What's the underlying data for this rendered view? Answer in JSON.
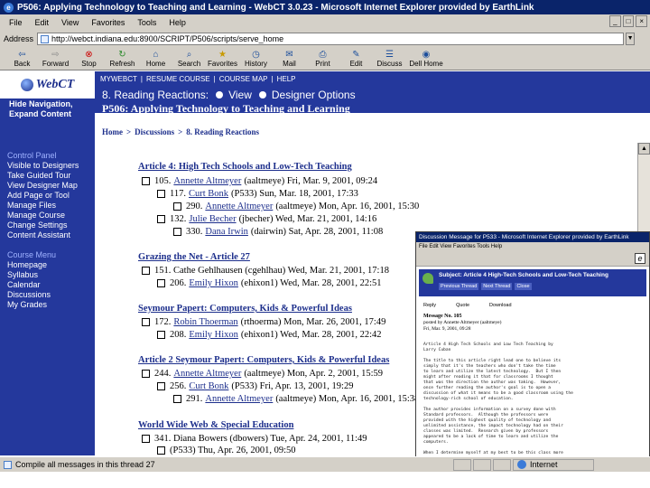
{
  "window": {
    "title": "P506: Applying Technology to Teaching and Learning - WebCT 3.0.23 - Microsoft Internet Explorer provided by EarthLink"
  },
  "menu": [
    "File",
    "Edit",
    "View",
    "Favorites",
    "Tools",
    "Help"
  ],
  "address": {
    "label": "Address",
    "url": "http://webct.indiana.edu:8900/SCRIPT/P506/scripts/serve_home"
  },
  "toolbar": [
    {
      "label": "Back",
      "icon": "back-arrow-icon"
    },
    {
      "label": "Forward",
      "icon": "forward-arrow-icon"
    },
    {
      "label": "Stop",
      "icon": "stop-icon"
    },
    {
      "label": "Refresh",
      "icon": "refresh-icon"
    },
    {
      "label": "Home",
      "icon": "home-icon"
    },
    {
      "label": "Search",
      "icon": "search-icon"
    },
    {
      "label": "Favorites",
      "icon": "favorites-icon"
    },
    {
      "label": "History",
      "icon": "history-icon"
    },
    {
      "label": "Mail",
      "icon": "mail-icon"
    },
    {
      "label": "Print",
      "icon": "print-icon"
    },
    {
      "label": "Edit",
      "icon": "edit-icon"
    },
    {
      "label": "Discuss",
      "icon": "discuss-icon"
    },
    {
      "label": "Dell Home",
      "icon": "dell-icon"
    }
  ],
  "sidebar": {
    "logo": "WebCT",
    "hide_nav": "Hide Navigation,",
    "expand": "Expand Content",
    "control_panel": {
      "header": "Control Panel",
      "items": [
        "Visible to Designers",
        "Take Guided Tour",
        "View Designer Map",
        "Add Page or Tool",
        "Manage Files",
        "Manage Course",
        "Change Settings",
        "Content Assistant"
      ]
    },
    "course_menu": {
      "header": "Course Menu",
      "items": [
        "Homepage",
        "Syllabus",
        "Calendar",
        "Discussions",
        "My Grades"
      ]
    }
  },
  "navrow": [
    "MYWEBCT",
    "RESUME COURSE",
    "COURSE MAP",
    "HELP"
  ],
  "topic": {
    "heading": "8. Reading Reactions:",
    "view": "View",
    "designer": "Designer Options",
    "course": "P506: Applying Technology to Teaching and Learning"
  },
  "breadcrumb": [
    "Home",
    "Discussions",
    "8. Reading Reactions"
  ],
  "threads": [
    {
      "title": "Article 4: High Tech Schools and Low-Tech Teaching",
      "messages": [
        {
          "id": "105.",
          "author": "Annette Altmeyer",
          "rest": "(aaltmeye) Fri, Mar. 9, 2001, 09:24"
        },
        {
          "id": "117.",
          "author": "Curt Bonk",
          "rest": "(P533) Sun, Mar. 18, 2001, 17:33"
        },
        {
          "id": "290.",
          "author": "Annette Altmeyer",
          "rest": "(aaltmeye) Mon, Apr. 16, 2001, 15:30"
        },
        {
          "id": "132.",
          "author": "Julie Becher",
          "rest": "(jbecher) Wed, Mar. 21, 2001, 14:16"
        },
        {
          "id": "330.",
          "author": "Dana Irwin",
          "rest": "(dairwin) Sat, Apr. 28, 2001, 11:08"
        }
      ]
    },
    {
      "title": "Grazing the Net - Article 27",
      "messages": [
        {
          "id": "151.",
          "author": "",
          "rest": "Cathe Gehlhausen (cgehlhau) Wed, Mar. 21, 2001, 17:18"
        },
        {
          "id": "206.",
          "author": "Emily Hixon",
          "rest": "(ehixon1) Wed, Mar. 28, 2001, 22:51"
        }
      ]
    },
    {
      "title": "Seymour Papert: Computers, Kids & Powerful Ideas",
      "messages": [
        {
          "id": "172.",
          "author": "Robin Thoerman",
          "rest": "(rthoerma) Mon, Mar. 26, 2001, 17:49"
        },
        {
          "id": "208.",
          "author": "Emily Hixon",
          "rest": "(ehixon1) Wed, Mar. 28, 2001, 22:42"
        }
      ]
    },
    {
      "title": "Article 2 Seymour Papert: Computers, Kids & Powerful Ideas",
      "messages": [
        {
          "id": "244.",
          "author": "Annette Altmeyer",
          "rest": "(aaltmeye) Mon, Apr. 2, 2001, 15:59"
        },
        {
          "id": "256.",
          "author": "Curt Bonk",
          "rest": "(P533) Fri, Apr. 13, 2001, 19:29"
        },
        {
          "id": "291.",
          "author": "Annette Altmeyer",
          "rest": "(aaltmeye) Mon, Apr. 16, 2001, 15:38"
        }
      ]
    },
    {
      "title": "World Wide Web & Special Education",
      "messages": [
        {
          "id": "341.",
          "author": "",
          "rest": "Diana Bowers (dbowers) Tue, Apr. 24, 2001, 11:49"
        },
        {
          "id": "",
          "author": "",
          "rest": "(P533) Thu, Apr. 26, 2001, 09:50"
        }
      ]
    }
  ],
  "popup": {
    "title": "Discussion Message for P533 - Microsoft Internet Explorer provided by EarthLink",
    "menu": "File  Edit  View  Favorites  Tools  Help",
    "subject": "Subject: Article 4 High-Tech Schools and Low-Tech Teaching",
    "buttons": [
      "Previous Thread",
      "Next Thread",
      "Close"
    ],
    "actions": [
      "Reply",
      "Quote",
      "Download"
    ],
    "msg_no": "Message No. 105",
    "posted": "posted by Annette Altmeyer (aaltmeye)",
    "date": "Fri, Mar. 9, 2001, 09:28",
    "body": "Article 4 High Tech Schools and Low Tech Teaching by\nLarry Cuban\n\nThe title to this article right lead one to believe its\nsimply that it's the teachers who don't take the time\nto learn and utilize the latest technology.  But I then\nmight after reading it that for classrooms I thought\nthat was the direction the author was taking.  However,\nonce further reading the author's goal is to open a\ndiscussion of what it means to be a good classroom using the\ntechnology-rich school of education.\n\nThe author provides information on a survey done with\nStandard professors.  Although the professors were\nprovided with the highest quality of technology and\nunlimited assistance, the impact technology had on their\nclasses was limited.  Research given by professors\nappeared to be a lack of time to learn and utilize the\ncomputers.\n\nWhen I determine myself at my best to be this class more"
  },
  "status": {
    "text": "Compile all messages in this thread 27",
    "zone": "Internet"
  }
}
